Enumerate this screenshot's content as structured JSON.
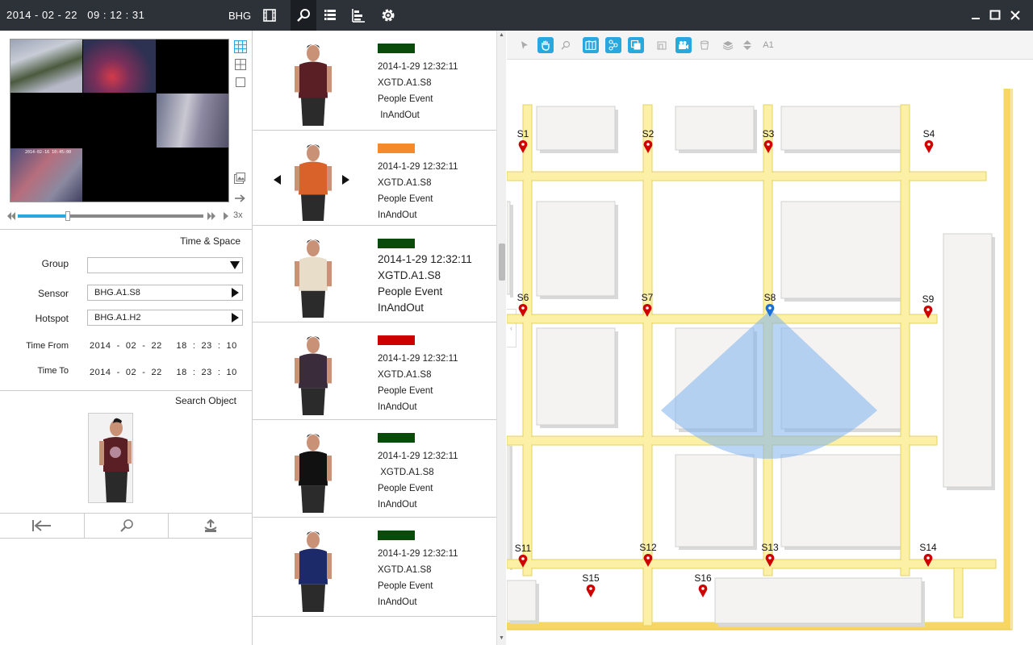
{
  "titlebar": {
    "datetime": "2014 - 02 - 22   09 : 12 : 31",
    "site": "BHG",
    "icons": [
      "film-icon",
      "search-icon",
      "list-icon",
      "bar-chart-icon",
      "gear-icon"
    ],
    "active_icon": "search-icon"
  },
  "video": {
    "grid_rows": 3,
    "grid_cols": 3,
    "cam4_stamp": "2014-02-16  10:45:00",
    "speed": "3x",
    "progress": 0.27
  },
  "form": {
    "time_space_title": "Time & Space",
    "group_label": "Group",
    "group_value": "",
    "sensor_label": "Sensor",
    "sensor_value": "BHG.A1.S8",
    "hotspot_label": "Hotspot",
    "hotspot_value": "BHG.A1.H2",
    "time_from_label": "Time From",
    "time_from_value": "2014  -  02  -  22     18  :  23  :  10",
    "time_to_label": "Time To",
    "time_to_value": "2014  -  02  -  22     18  :  23  :  10",
    "search_object_title": "Search Object"
  },
  "results": [
    {
      "color": "#0a4a0a",
      "time": "2014-1-29 12:32:11",
      "sensor": "XGTD.A1.S8",
      "event": "People Event",
      "direction": " InAndOut",
      "big": false,
      "arrows": false
    },
    {
      "color": "#f58a2a",
      "time": "2014-1-29 12:32:11",
      "sensor": "XGTD.A1.S8",
      "event": "People Event",
      "direction": "InAndOut",
      "big": false,
      "arrows": true
    },
    {
      "color": "#0a4a0a",
      "time": "2014-1-29 12:32:11",
      "sensor": "XGTD.A1.S8",
      "event": "People Event",
      "direction": "InAndOut",
      "big": true,
      "arrows": false
    },
    {
      "color": "#cc0000",
      "time": "2014-1-29 12:32:11",
      "sensor": "XGTD.A1.S8",
      "event": "People Event",
      "direction": "InAndOut",
      "big": false,
      "arrows": false
    },
    {
      "color": "#0a4a0a",
      "time": "2014-1-29 12:32:11",
      "sensor": " XGTD.A1.S8",
      "event": "People Event",
      "direction": "InAndOut",
      "big": false,
      "arrows": false
    },
    {
      "color": "#0a4a0a",
      "time": "2014-1-29 12:32:11",
      "sensor": "XGTD.A1.S8",
      "event": "People Event",
      "direction": "InAndOut",
      "big": false,
      "arrows": false
    }
  ],
  "map": {
    "floor_label": "A1",
    "sensors": [
      {
        "name": "S1",
        "color": "#d10000"
      },
      {
        "name": "S2",
        "color": "#d10000"
      },
      {
        "name": "S3",
        "color": "#d10000"
      },
      {
        "name": "S4",
        "color": "#d10000"
      },
      {
        "name": "S6",
        "color": "#d10000"
      },
      {
        "name": "S7",
        "color": "#d10000"
      },
      {
        "name": "S8",
        "color": "#1a6ed8"
      },
      {
        "name": "S9",
        "color": "#d10000"
      },
      {
        "name": "S11",
        "color": "#d10000"
      },
      {
        "name": "S12",
        "color": "#d10000"
      },
      {
        "name": "S13",
        "color": "#d10000"
      },
      {
        "name": "S14",
        "color": "#d10000"
      },
      {
        "name": "S15",
        "color": "#d10000"
      },
      {
        "name": "S16",
        "color": "#d10000"
      }
    ],
    "road_color": "#fbf0a6",
    "road_border": "#e6d264",
    "accent": "#29a8e0"
  }
}
